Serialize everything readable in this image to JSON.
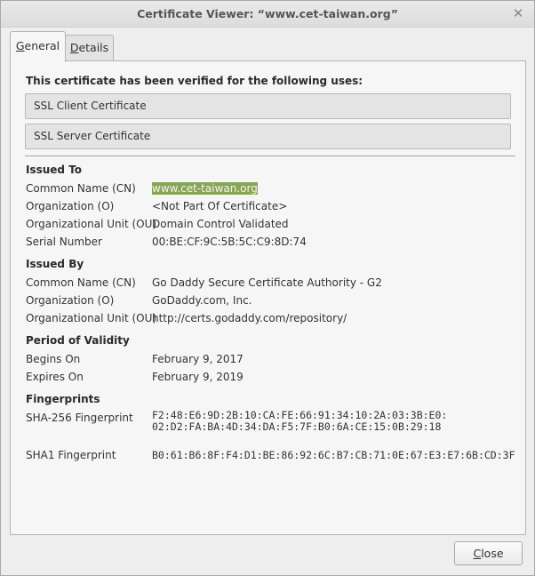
{
  "window": {
    "title": "Certificate Viewer: “www.cet-taiwan.org”"
  },
  "tabs": [
    {
      "label": "General",
      "active": true
    },
    {
      "label": "Details",
      "active": false
    }
  ],
  "verified": {
    "heading": "This certificate has been verified for the following uses:",
    "uses": [
      "SSL Client Certificate",
      "SSL Server Certificate"
    ]
  },
  "issued_to": {
    "title": "Issued To",
    "rows": [
      {
        "label": "Common Name (CN)",
        "value": "www.cet-taiwan.org"
      },
      {
        "label": "Organization (O)",
        "value": "<Not Part Of Certificate>"
      },
      {
        "label": "Organizational Unit (OU)",
        "value": "Domain Control Validated"
      },
      {
        "label": "Serial Number",
        "value": "00:BE:CF:9C:5B:5C:C9:8D:74"
      }
    ]
  },
  "issued_by": {
    "title": "Issued By",
    "rows": [
      {
        "label": "Common Name (CN)",
        "value": "Go Daddy Secure Certificate Authority - G2"
      },
      {
        "label": "Organization (O)",
        "value": "GoDaddy.com, Inc."
      },
      {
        "label": "Organizational Unit (OU)",
        "value": "http://certs.godaddy.com/repository/"
      }
    ]
  },
  "validity": {
    "title": "Period of Validity",
    "rows": [
      {
        "label": "Begins On",
        "value": "February 9, 2017"
      },
      {
        "label": "Expires On",
        "value": "February 9, 2019"
      }
    ]
  },
  "fingerprints": {
    "title": "Fingerprints",
    "sha256_label": "SHA-256 Fingerprint",
    "sha256_line1": "F2:48:E6:9D:2B:10:CA:FE:66:91:34:10:2A:03:3B:E0:",
    "sha256_line2": "02:D2:FA:BA:4D:34:DA:F5:7F:B0:6A:CE:15:0B:29:18",
    "sha1_label": "SHA1 Fingerprint",
    "sha1_value": "B0:61:B6:8F:F4:D1:BE:86:92:6C:B7:CB:71:0E:67:E3:E7:6B:CD:3F"
  },
  "footer": {
    "close_label": "Close"
  },
  "colors": {
    "selection_highlight": "#87a556"
  },
  "icons": {
    "close": "close-icon"
  }
}
